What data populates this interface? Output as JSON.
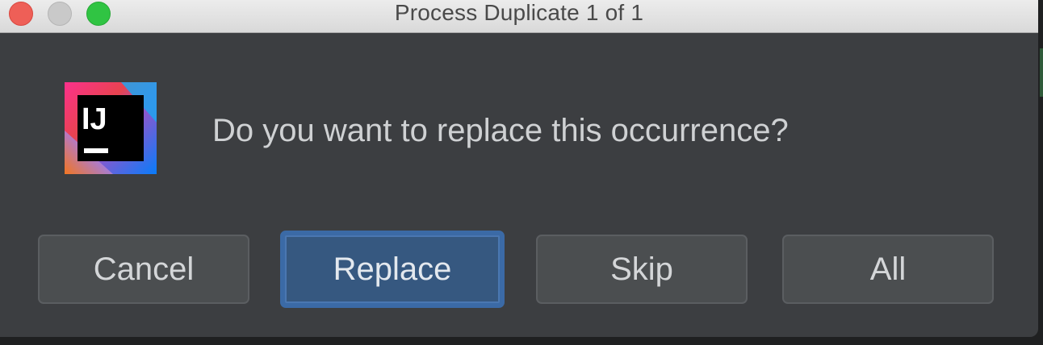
{
  "window": {
    "title": "Process Duplicate 1 of 1"
  },
  "dialog": {
    "message": "Do you want to replace this occurrence?",
    "logo_text": "IJ"
  },
  "buttons": {
    "cancel": "Cancel",
    "replace": "Replace",
    "skip": "Skip",
    "all": "All"
  },
  "colors": {
    "dialog_background": "#3c3e41",
    "default_button": "#365880",
    "button": "#4b4e50"
  }
}
